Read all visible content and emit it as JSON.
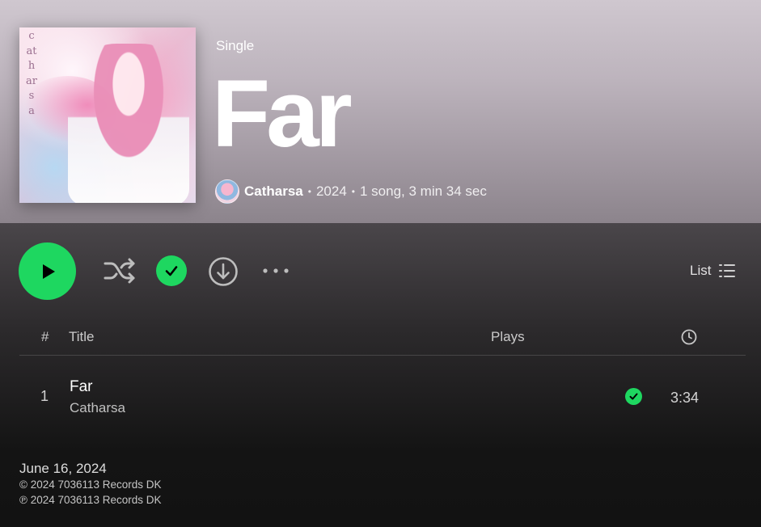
{
  "album": {
    "type_label": "Single",
    "title": "Far",
    "cover_text": "catharsa",
    "artist": "Catharsa",
    "year": "2024",
    "summary": "1 song, 3 min 34 sec",
    "separator": "•"
  },
  "controls": {
    "play_icon": "play-icon",
    "shuffle_icon": "shuffle-icon",
    "saved_icon": "check-circle-icon",
    "download_icon": "download-icon",
    "more_icon": "more-icon",
    "view_label": "List",
    "accent_color": "#1ed760"
  },
  "tracklist": {
    "columns": {
      "number": "#",
      "title": "Title",
      "plays": "Plays",
      "duration_icon": "clock-icon"
    },
    "tracks": [
      {
        "number": "1",
        "title": "Far",
        "artist": "Catharsa",
        "plays": "",
        "saved": true,
        "duration": "3:34"
      }
    ]
  },
  "footer": {
    "release_date": "June 16, 2024",
    "copyright": "© 2024 7036113 Records DK",
    "phonographic": "℗ 2024 7036113 Records DK"
  }
}
